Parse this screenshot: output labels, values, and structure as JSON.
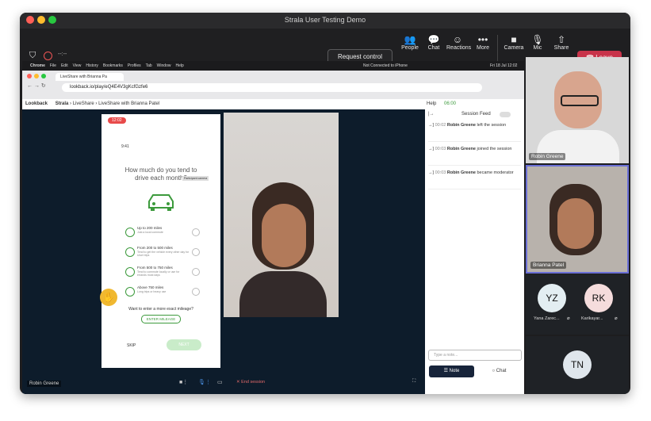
{
  "window": {
    "title": "Strala User Testing Demo"
  },
  "toolbar": {
    "left_info": "--:--",
    "request_control": "Request control",
    "people": "People",
    "chat": "Chat",
    "reactions": "Reactions",
    "more": "More",
    "camera": "Camera",
    "mic": "Mic",
    "share": "Share",
    "leave": "Leave"
  },
  "browser": {
    "mac_menu": [
      "Chrome",
      "File",
      "Edit",
      "View",
      "History",
      "Bookmarks",
      "Profiles",
      "Tab",
      "Window",
      "Help"
    ],
    "mac_status": "Not Connected to iPhone",
    "mac_clock": "Fri 18 Jul 12:02",
    "tab_title": "LiveShare with Brianna Pa",
    "url": "lookback.io/play/eQ4E4V3gKcfGzfe6"
  },
  "lookback": {
    "logo": "Lookback",
    "breadcrumb": [
      "Strala",
      "LiveShare",
      "LiveShare with Brianna Patel"
    ],
    "help": "Help",
    "timer": "06:00"
  },
  "phone": {
    "record_time": "12:02",
    "status_time": "9:41",
    "question": "How much do you tend to drive each month?",
    "tooltip": "Participant camera",
    "options": [
      {
        "title": "Up to 200 miles",
        "desc": "Just a local commute"
      },
      {
        "title": "From 200 to 500 miles",
        "desc": "Tend to get the vehicle every other day for short trips"
      },
      {
        "title": "From 500 to 750 miles",
        "desc": "Tend to commute locally or use for errands most days"
      },
      {
        "title": "Above 750 miles",
        "desc": "Long trips or heavy use"
      }
    ],
    "exact_prompt": "Want to enter a more exact mileage?",
    "enter_mileage": "ENTER MILEAGE",
    "skip": "SKIP",
    "next": "NEXT"
  },
  "session_feed": {
    "title": "Session Feed",
    "items": [
      {
        "time": "00:02",
        "name": "Robin Greene",
        "text": "left the session"
      },
      {
        "time": "00:03",
        "name": "Robin Greene",
        "text": "joined the session"
      },
      {
        "time": "00:03",
        "name": "Robin Greene",
        "text": "became moderator"
      }
    ],
    "note_placeholder": "Type a note...",
    "note_btn": "Note",
    "chat_btn": "Chat"
  },
  "share_bottom": {
    "presenter": "Robin Greene",
    "end_session": "End session"
  },
  "participants": {
    "robin": "Robin Greene",
    "brianna": "Brianna Patel",
    "yz_initials": "YZ",
    "yz_name": "Yana Zarec...",
    "rk_initials": "RK",
    "rk_name": "Karikayar...",
    "tn_initials": "TN"
  },
  "colors": {
    "leave": "#c8334a",
    "accent_green": "#3c9a3c",
    "timer_red": "#e84a4a",
    "speaker_border": "#6a6fd6"
  }
}
